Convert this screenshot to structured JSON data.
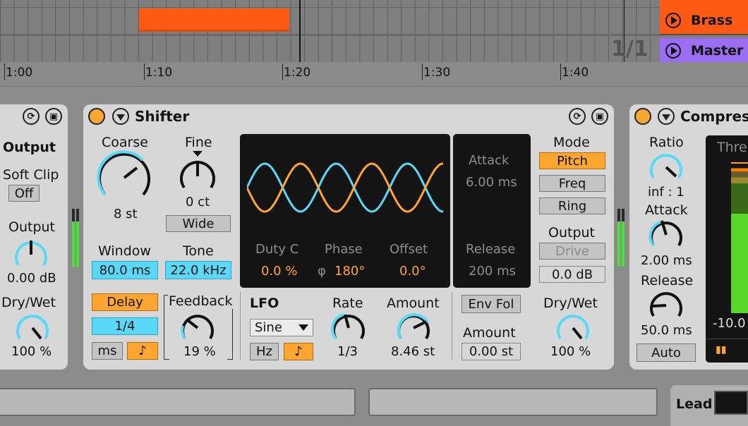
{
  "arrangement": {
    "tracks": [
      {
        "name": "Brass",
        "color": "#ff5a14"
      },
      {
        "name": "Master",
        "color": "#9a6df2"
      }
    ],
    "signature": "1/1",
    "ruler": [
      "1:00",
      "1:10",
      "1:20",
      "1:30",
      "1:40"
    ]
  },
  "left_device": {
    "title": "Output",
    "soft_clip_label": "Soft Clip",
    "soft_clip_value": "Off",
    "output_label": "Output",
    "output_value": "0.00 dB",
    "drywet_label": "Dry/Wet",
    "drywet_value": "100 %"
  },
  "shifter": {
    "title": "Shifter",
    "coarse_label": "Coarse",
    "coarse_value": "8 st",
    "fine_label": "Fine",
    "fine_value": "0 ct",
    "wide_label": "Wide",
    "window_label": "Window",
    "window_value": "80.0 ms",
    "tone_label": "Tone",
    "tone_value": "22.0 kHz",
    "display": {
      "duty_label": "Duty C",
      "duty_value": "0.0 %",
      "phase_label": "Phase",
      "phase_value": "180°",
      "offset_label": "Offset",
      "offset_value": "0.0°"
    },
    "env": {
      "attack_label": "Attack",
      "attack_value": "6.00 ms",
      "release_label": "Release",
      "release_value": "200 ms"
    },
    "mode_label": "Mode",
    "modes": [
      "Pitch",
      "Freq",
      "Ring"
    ],
    "output_label": "Output",
    "drive_label": "Drive",
    "output_value": "0.0 dB",
    "delay_label": "Delay",
    "delay_value": "1/4",
    "ms_label": "ms",
    "note_icon": "♪",
    "feedback_label": "Feedback",
    "feedback_value": "19 %",
    "lfo_label": "LFO",
    "lfo_shape": "Sine",
    "hz_label": "Hz",
    "rate_label": "Rate",
    "rate_value": "1/3",
    "amount_label": "Amount",
    "amount_value": "8.46 st",
    "envfol_label": "Env Fol",
    "envfol_amount_label": "Amount",
    "envfol_amount_value": "0.00 st",
    "drywet_label": "Dry/Wet",
    "drywet_value": "100 %"
  },
  "compressor": {
    "title": "Compress",
    "ratio_label": "Ratio",
    "ratio_value": "inf : 1",
    "attack_label": "Attack",
    "attack_value": "2.00 ms",
    "release_label": "Release",
    "release_value": "50.0 ms",
    "auto_label": "Auto",
    "thresh_label": "Thre",
    "thresh_value": "-10.0"
  },
  "bottom": {
    "track_label": "Lead"
  },
  "colors": {
    "accent": "#ffa531",
    "cyan": "#5ad8f8",
    "brass": "#ff5a14",
    "master": "#9a6df2"
  }
}
